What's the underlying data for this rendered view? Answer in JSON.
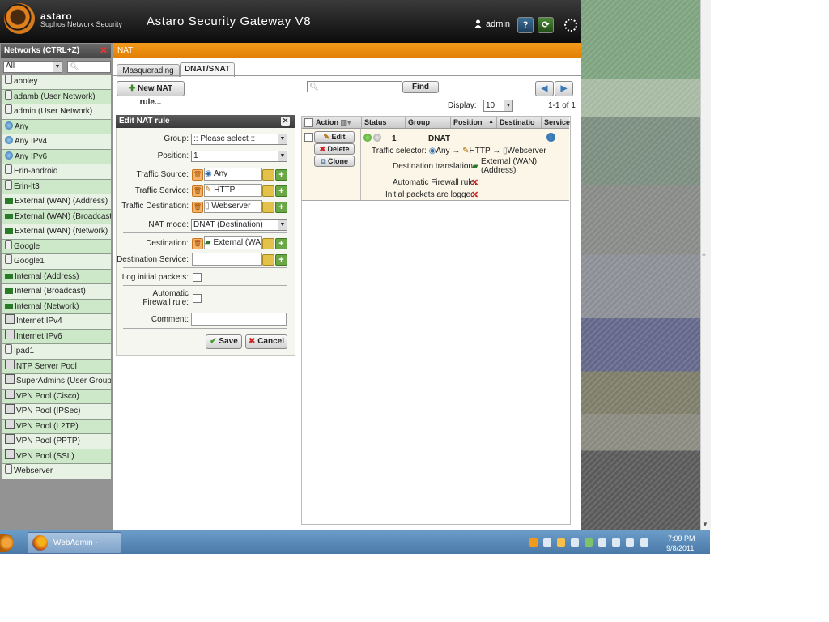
{
  "header": {
    "brand": "astaro",
    "brand_sub": "Sophos Network Security",
    "product_title": "Astaro Security Gateway V8",
    "user": "admin",
    "help_label": "?",
    "reload_label": "⟳"
  },
  "sidebar": {
    "title": "Networks (CTRL+Z)",
    "filter_value": "All",
    "items": [
      {
        "label": "aboley",
        "icon": "host-icon"
      },
      {
        "label": "adamb (User Network)",
        "icon": "host-icon"
      },
      {
        "label": "admin (User Network)",
        "icon": "host-icon"
      },
      {
        "label": "Any",
        "icon": "globe-icon"
      },
      {
        "label": "Any IPv4",
        "icon": "globe-icon"
      },
      {
        "label": "Any IPv6",
        "icon": "globe-icon"
      },
      {
        "label": "Erin-android",
        "icon": "host-icon"
      },
      {
        "label": "Erin-lt3",
        "icon": "host-icon"
      },
      {
        "label": "External (WAN) (Address)",
        "icon": "interface-icon"
      },
      {
        "label": "External (WAN) (Broadcast)",
        "icon": "interface-icon"
      },
      {
        "label": "External (WAN) (Network)",
        "icon": "interface-icon"
      },
      {
        "label": "Google",
        "icon": "host-icon"
      },
      {
        "label": "Google1",
        "icon": "host-icon"
      },
      {
        "label": "Internal (Address)",
        "icon": "interface-icon"
      },
      {
        "label": "Internal (Broadcast)",
        "icon": "interface-icon"
      },
      {
        "label": "Internal (Network)",
        "icon": "interface-icon"
      },
      {
        "label": "Internet IPv4",
        "icon": "network-icon"
      },
      {
        "label": "Internet IPv6",
        "icon": "network-icon"
      },
      {
        "label": "Ipad1",
        "icon": "host-icon"
      },
      {
        "label": "NTP Server Pool",
        "icon": "network-icon"
      },
      {
        "label": "SuperAdmins (User Group Ne",
        "icon": "network-icon"
      },
      {
        "label": "VPN Pool (Cisco)",
        "icon": "network-icon"
      },
      {
        "label": "VPN Pool (IPSec)",
        "icon": "network-icon"
      },
      {
        "label": "VPN Pool (L2TP)",
        "icon": "network-icon"
      },
      {
        "label": "VPN Pool (PPTP)",
        "icon": "network-icon"
      },
      {
        "label": "VPN Pool (SSL)",
        "icon": "network-icon"
      },
      {
        "label": "Webserver",
        "icon": "host-icon"
      }
    ]
  },
  "nat": {
    "section_title": "NAT",
    "tabs": [
      "Masquerading",
      "DNAT/SNAT"
    ],
    "new_rule_label": "New NAT rule...",
    "find_label": "Find",
    "display_label": "Display:",
    "display_value": "10",
    "page_range": "1-1 of 1"
  },
  "edit_panel": {
    "title": "Edit NAT rule",
    "close_label": "✕",
    "group_label": "Group:",
    "group_value": ":: Please select ::",
    "position_label": "Position:",
    "position_value": "1",
    "traffic_source_label": "Traffic Source:",
    "traffic_source_value": "Any",
    "traffic_service_label": "Traffic Service:",
    "traffic_service_value": "HTTP",
    "traffic_destination_label": "Traffic Destination:",
    "traffic_destination_value": "Webserver",
    "nat_mode_label": "NAT mode:",
    "nat_mode_value": "DNAT (Destination)",
    "destination_label": "Destination:",
    "destination_value": "External (WAN",
    "destination_service_label": "Destination Service:",
    "log_label": "Log initial packets:",
    "auto_fw_label_1": "Automatic",
    "auto_fw_label_2": "Firewall rule:",
    "comment_label": "Comment:",
    "save_label": "Save",
    "cancel_label": "Cancel"
  },
  "table": {
    "headers": [
      "Action",
      "Status",
      "Group",
      "Position",
      "Destinatio",
      "Service"
    ],
    "row": {
      "edit_label": "Edit",
      "delete_label": "Delete",
      "clone_label": "Clone",
      "position": "1",
      "type": "DNAT",
      "traffic_selector_label": "Traffic selector:",
      "ts_source": "Any",
      "ts_service": "HTTP",
      "ts_destination": "Webserver",
      "arrow": "→",
      "dest_translation_label": "Destination translation:",
      "dest_translation_value_1": "External (WAN)",
      "dest_translation_value_2": "(Address)",
      "auto_fw_label": "Automatic Firewall rule:",
      "logged_label": "Initial packets are logged:",
      "x_mark": "✕"
    }
  },
  "taskbar": {
    "task_label": "WebAdmin - User...",
    "time": "7:09 PM",
    "date": "9/8/2011"
  },
  "colors": {
    "accent_orange": "#e8890f",
    "list_green": "#cce8c8",
    "header_dark": "#1a1a1a",
    "taskbar_blue": "#5a87b6"
  }
}
